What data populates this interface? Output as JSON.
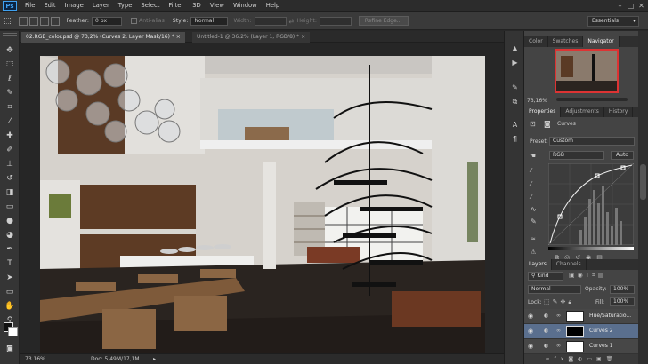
{
  "app": {
    "logo": "Ps",
    "brand_color": "#3fa1f0"
  },
  "menu": [
    "File",
    "Edit",
    "Image",
    "Layer",
    "Type",
    "Select",
    "Filter",
    "3D",
    "View",
    "Window",
    "Help"
  ],
  "options": {
    "feather_label": "Feather:",
    "feather_value": "0 px",
    "antialias_label": "Anti-alias",
    "style_label": "Style:",
    "style_value": "Normal",
    "width_label": "Width:",
    "height_label": "Height:",
    "refine_label": "Refine Edge...",
    "workspace": "Essentials"
  },
  "tabs": [
    {
      "label": "02.RGB_color.psd @ 73,2% (Curves 2, Layer Mask/16) *",
      "active": true
    },
    {
      "label": "Untitled-1 @ 36,2% (Layer 1, RGB/8) *",
      "active": false
    }
  ],
  "status": {
    "zoom": "73.16%",
    "doc": "Doc: 5,49M/17,1M"
  },
  "navigator": {
    "tabs": [
      "Color",
      "Swatches",
      "Navigator"
    ],
    "zoom": "73,16%"
  },
  "properties": {
    "tabs": [
      "Properties",
      "Adjustments",
      "History"
    ],
    "title": "Curves",
    "preset_label": "Preset:",
    "preset_value": "Custom",
    "channel_value": "RGB",
    "auto_label": "Auto"
  },
  "layers_panel": {
    "tabs": [
      "Layers",
      "Channels"
    ],
    "kind_label": "Kind",
    "blend_mode": "Normal",
    "opacity_label": "Opacity:",
    "opacity_value": "100%",
    "lock_label": "Lock:",
    "fill_label": "Fill:",
    "fill_value": "100%",
    "layers": [
      {
        "name": "Hue/Saturatio...",
        "mask": "white",
        "selected": false
      },
      {
        "name": "Curves 2",
        "mask": "black",
        "selected": true
      },
      {
        "name": "Curves 1",
        "mask": "white",
        "selected": false
      }
    ]
  },
  "icons": [
    "marquee-icon",
    "lasso-icon",
    "quick-select-icon",
    "crop-icon",
    "eyedropper-icon",
    "heal-icon",
    "brush-icon",
    "stamp-icon",
    "history-brush-icon",
    "eraser-icon",
    "gradient-icon",
    "blur-icon",
    "dodge-icon",
    "pen-icon",
    "type-icon",
    "path-select-icon",
    "shape-icon",
    "hand-icon",
    "zoom-icon"
  ]
}
